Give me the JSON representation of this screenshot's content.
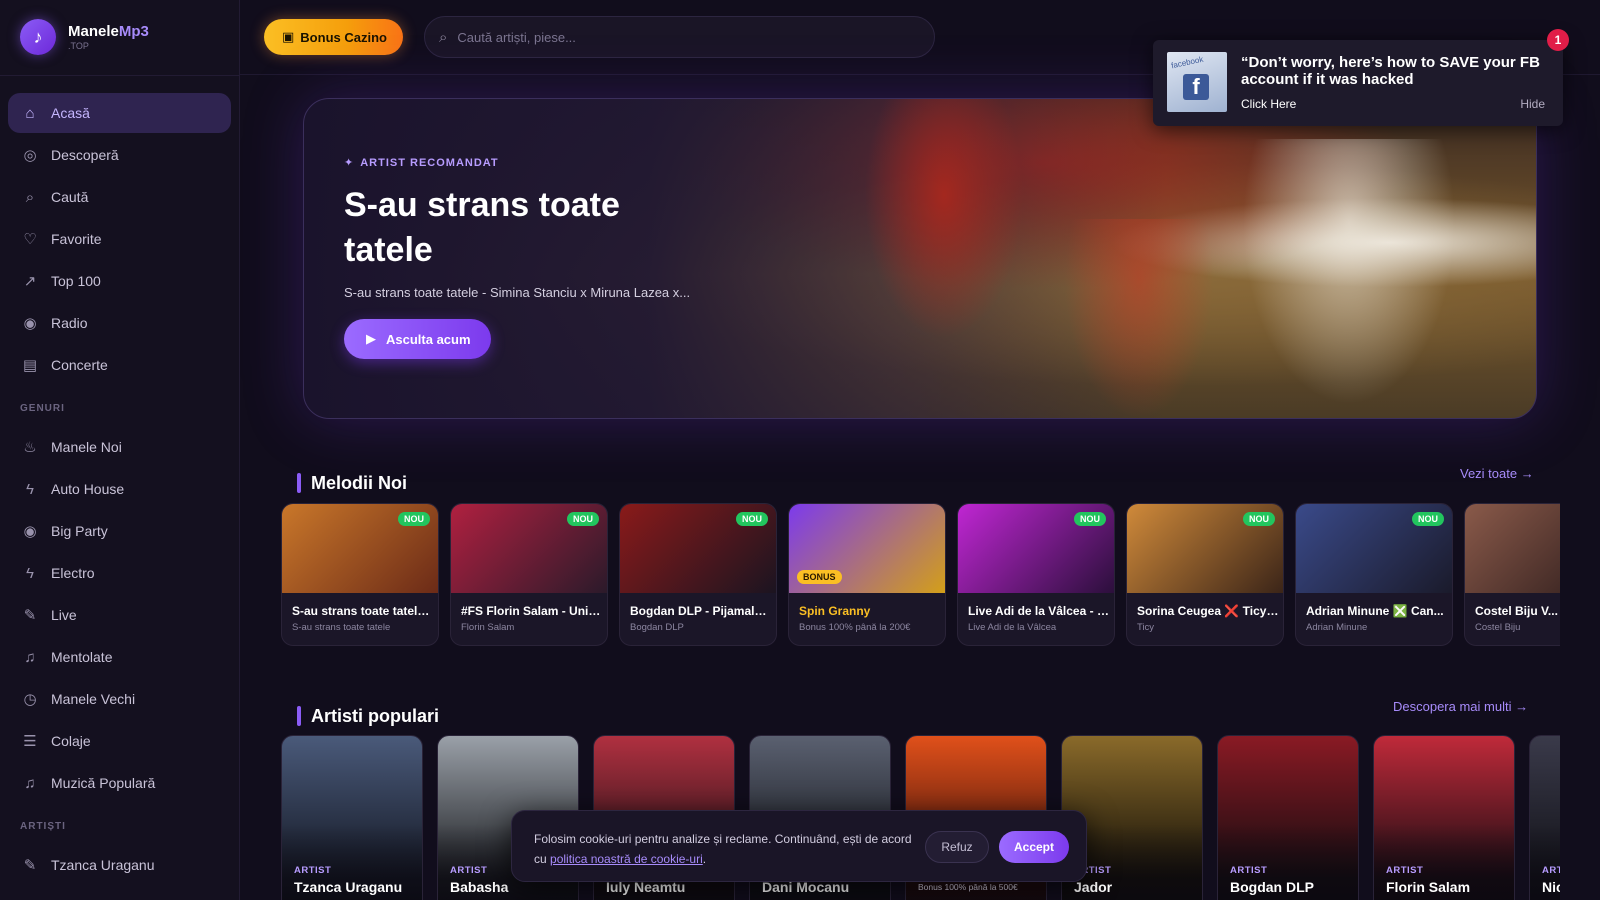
{
  "brand": {
    "name_a": "Manele",
    "name_b": "Mp3",
    "domain": ".TOP"
  },
  "topbar": {
    "bonus_label": "Bonus Cazino",
    "search_placeholder": "Caută artiști, piese..."
  },
  "notification": {
    "title": "“Don’t worry, here’s how to SAVE your FB account if it was hacked",
    "click": "Click Here",
    "hide": "Hide",
    "badge_count": "1",
    "thumb_text": "facebook"
  },
  "sidebar": {
    "main": [
      {
        "label": "Acasă",
        "icon": "home-icon",
        "glyph": "⌂"
      },
      {
        "label": "Descoperă",
        "icon": "compass-icon",
        "glyph": "◎"
      },
      {
        "label": "Caută",
        "icon": "search-icon",
        "glyph": "⌕"
      },
      {
        "label": "Favorite",
        "icon": "heart-icon",
        "glyph": "♡"
      },
      {
        "label": "Top 100",
        "icon": "trending-icon",
        "glyph": "↗"
      },
      {
        "label": "Radio",
        "icon": "radio-icon",
        "glyph": "◉"
      },
      {
        "label": "Concerte",
        "icon": "ticket-icon",
        "glyph": "▤"
      }
    ],
    "genres_label": "GENURI",
    "genres": [
      {
        "label": "Manele Noi",
        "icon": "flame-icon",
        "glyph": "♨"
      },
      {
        "label": "Auto House",
        "icon": "bolt-icon",
        "glyph": "ϟ"
      },
      {
        "label": "Big Party",
        "icon": "radio-icon",
        "glyph": "◉"
      },
      {
        "label": "Electro",
        "icon": "bolt-icon",
        "glyph": "ϟ"
      },
      {
        "label": "Live",
        "icon": "mic-icon",
        "glyph": "✎"
      },
      {
        "label": "Mentolate",
        "icon": "music-note-icon",
        "glyph": "♫"
      },
      {
        "label": "Manele Vechi",
        "icon": "clock-icon",
        "glyph": "◷"
      },
      {
        "label": "Colaje",
        "icon": "list-icon",
        "glyph": "☰"
      },
      {
        "label": "Muzică Populară",
        "icon": "music-note-icon",
        "glyph": "♫"
      }
    ],
    "artists_label": "ARTIȘTI",
    "artists": [
      {
        "label": "Tzanca Uraganu",
        "icon": "mic-icon",
        "glyph": "✎"
      }
    ]
  },
  "hero": {
    "tag": "ARTIST RECOMANDAT",
    "title": "S-au strans toate tatele",
    "subtitle": "S-au strans toate tatele - Simina Stanciu x Miruna Lazea x...",
    "button": "Asculta acum"
  },
  "new_songs": {
    "title": "Melodii Noi",
    "link": "Vezi toate →",
    "badge_label": "NOU",
    "bonus_badge_label": "BONUS",
    "items": [
      {
        "title": "S-au strans toate tatele...",
        "sub": "S-au strans toate tatele",
        "badge": "nou",
        "c1": "#c9772a",
        "c2": "#6b2a17"
      },
      {
        "title": "#FS Florin Salam - Uniq...",
        "sub": "Florin Salam",
        "badge": "nou",
        "c1": "#b02040",
        "c2": "#2a1a2a"
      },
      {
        "title": "Bogdan DLP - Pijamale ...",
        "sub": "Bogdan DLP",
        "badge": "nou",
        "c1": "#8a1a1a",
        "c2": "#1a1420"
      },
      {
        "title": "Spin Granny",
        "sub": "Bonus 100% până la 200€",
        "badge": "bonus",
        "c1": "#7c3aed",
        "c2": "#d4a017",
        "gold": true
      },
      {
        "title": "Live Adi de la Vâlcea - T...",
        "sub": "Live Adi de la Vâlcea",
        "badge": "nou",
        "c1": "#c026d3",
        "c2": "#2a0f3a"
      },
      {
        "title": "Sorina Ceugea ❌ Ticy ...",
        "sub": "Ticy",
        "badge": "nou",
        "c1": "#d08a3a",
        "c2": "#3a2418"
      },
      {
        "title": "Adrian Minune ❎ Can...",
        "sub": "Adrian Minune",
        "badge": "nou",
        "c1": "#3a4a8a",
        "c2": "#1a1a2a"
      },
      {
        "title": "Costel Biju V...",
        "sub": "Costel Biju",
        "badge": "none",
        "c1": "#8a5a4a",
        "c2": "#2a1a1a"
      }
    ]
  },
  "artists": {
    "title": "Artisti populari",
    "link": "Descopera mai multi →",
    "items": [
      {
        "tag": "ARTIST",
        "name": "Tzanca Uraganu",
        "c1": "#4a5a7a",
        "c2": "#141824"
      },
      {
        "tag": "ARTIST",
        "name": "Babasha",
        "c1": "#9aa0a8",
        "c2": "#1a1c20"
      },
      {
        "tag": "",
        "name": "Iuly Neamtu",
        "c1": "#b03040",
        "c2": "#1a1014"
      },
      {
        "tag": "",
        "name": "Dani Mocanu",
        "c1": "#5a6070",
        "c2": "#121418"
      },
      {
        "tag": "",
        "name": "",
        "small": "Bonus 100% până la 500€",
        "c1": "#e0501a",
        "c2": "#3a0f0a"
      },
      {
        "tag": "ARTIST",
        "name": "Jador",
        "c1": "#8a6a2a",
        "c2": "#141008"
      },
      {
        "tag": "ARTIST",
        "name": "Bogdan DLP",
        "c1": "#8a1a24",
        "c2": "#140c10"
      },
      {
        "tag": "ARTIST",
        "name": "Florin Salam",
        "c1": "#c02a3a",
        "c2": "#1a0c12"
      },
      {
        "tag": "ART",
        "name": "Nic",
        "c1": "#3a3a4a",
        "c2": "#121218"
      }
    ]
  },
  "cookie": {
    "text": "Folosim cookie-uri pentru analize și reclame. Continuând, ești de acord cu ",
    "link": "politica noastră de cookie-uri",
    "text_end": ".",
    "refuse": "Refuz",
    "accept": "Accept"
  },
  "colors": {
    "accent": "#8b5cf6",
    "bonus": "#f59e0b",
    "nou": "#22c55e",
    "background": "#110d1c"
  }
}
